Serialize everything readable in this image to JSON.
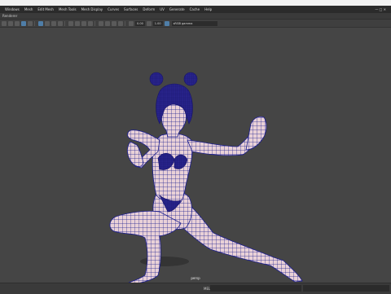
{
  "menu": [
    "Windows",
    "Mesh",
    "Edit Mesh",
    "Mesh Tools",
    "Mesh Display",
    "Curves",
    "Surfaces",
    "Deform",
    "UV",
    "Generate",
    "Cache",
    "Help"
  ],
  "window_controls": "— □ ✕",
  "panel_menu": "Renderer",
  "toolbar": {
    "value1": "0.00",
    "value2": "1.00",
    "colorspace": "sRGB gamma"
  },
  "viewport": {
    "camera_label": "persp"
  },
  "status": {
    "mel_label": "MEL"
  },
  "colors": {
    "wire": "#1b1e8e",
    "skin": "#e9d1d7",
    "shadow": "#2f2f2f",
    "viewport_bg": "#454545"
  }
}
